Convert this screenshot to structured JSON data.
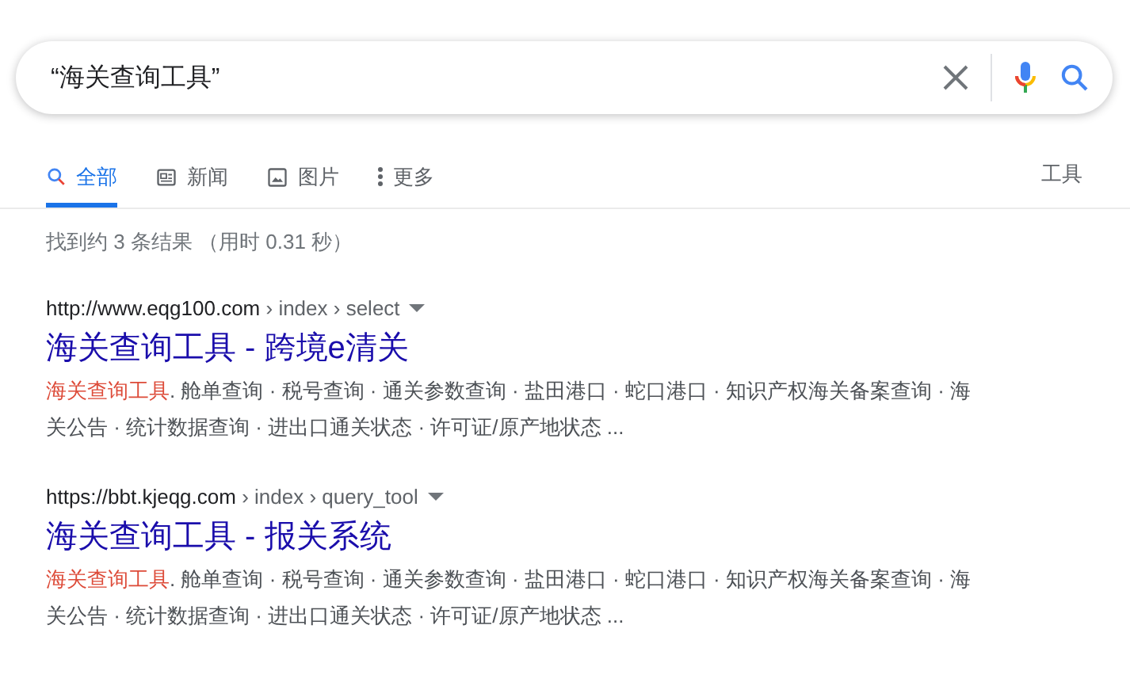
{
  "search": {
    "value": "“海关查询工具”"
  },
  "tabs": [
    {
      "label": "全部",
      "kind": "search",
      "selected": true
    },
    {
      "label": "新闻",
      "kind": "news",
      "selected": false
    },
    {
      "label": "图片",
      "kind": "image",
      "selected": false
    },
    {
      "label": "更多",
      "kind": "more",
      "selected": false
    }
  ],
  "tools": "工具",
  "stats": "找到约 3 条结果 （用时 0.31 秒）",
  "results": [
    {
      "host": "http://www.eqg100.com",
      "path": " › index › select",
      "title": "海关查询工具 - 跨境e清关",
      "highlight": "海关查询工具",
      "snippet": ". 舱单查询 · 税号查询 · 通关参数查询 · 盐田港口 · 蛇口港口 · 知识产权海关备案查询 · 海关公告 · 统计数据查询 · 进出口通关状态 · 许可证/原产地状态 ..."
    },
    {
      "host": "https://bbt.kjeqg.com",
      "path": " › index › query_tool",
      "title": "海关查询工具 - 报关系统",
      "highlight": "海关查询工具",
      "snippet": ". 舱单查询 · 税号查询 · 通关参数查询 · 盐田港口 · 蛇口港口 · 知识产权海关备案查询 · 海关公告 · 统计数据查询 · 进出口通关状态 · 许可证/原产地状态 ..."
    }
  ]
}
